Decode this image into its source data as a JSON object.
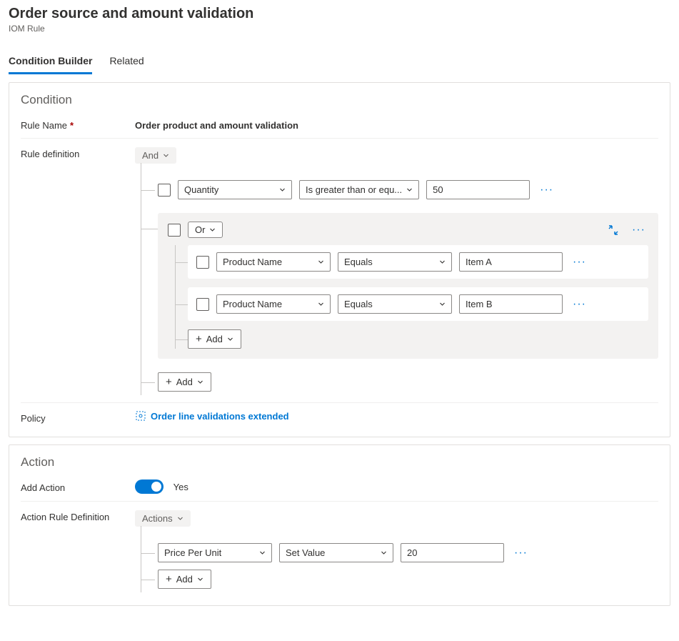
{
  "page": {
    "title": "Order source and amount validation",
    "subtitle": "IOM Rule"
  },
  "tabs": {
    "builder": "Condition Builder",
    "related": "Related"
  },
  "condition": {
    "heading": "Condition",
    "rule_name_label": "Rule Name",
    "rule_name_value": "Order product and amount validation",
    "rule_def_label": "Rule definition",
    "root_operator": "And",
    "rule1": {
      "field": "Quantity",
      "operator": "Is greater than or equ...",
      "value": "50"
    },
    "subgroup": {
      "operator": "Or",
      "rules": [
        {
          "field": "Product Name",
          "operator": "Equals",
          "value": "Item A"
        },
        {
          "field": "Product Name",
          "operator": "Equals",
          "value": "Item B"
        }
      ]
    },
    "add_label": "Add",
    "policy_label": "Policy",
    "policy_value": "Order line validations extended"
  },
  "action": {
    "heading": "Action",
    "add_action_label": "Add Action",
    "add_action_value": "Yes",
    "def_label": "Action Rule Definition",
    "root_operator": "Actions",
    "rule": {
      "field": "Price Per Unit",
      "operator": "Set Value",
      "value": "20"
    },
    "add_label": "Add"
  }
}
